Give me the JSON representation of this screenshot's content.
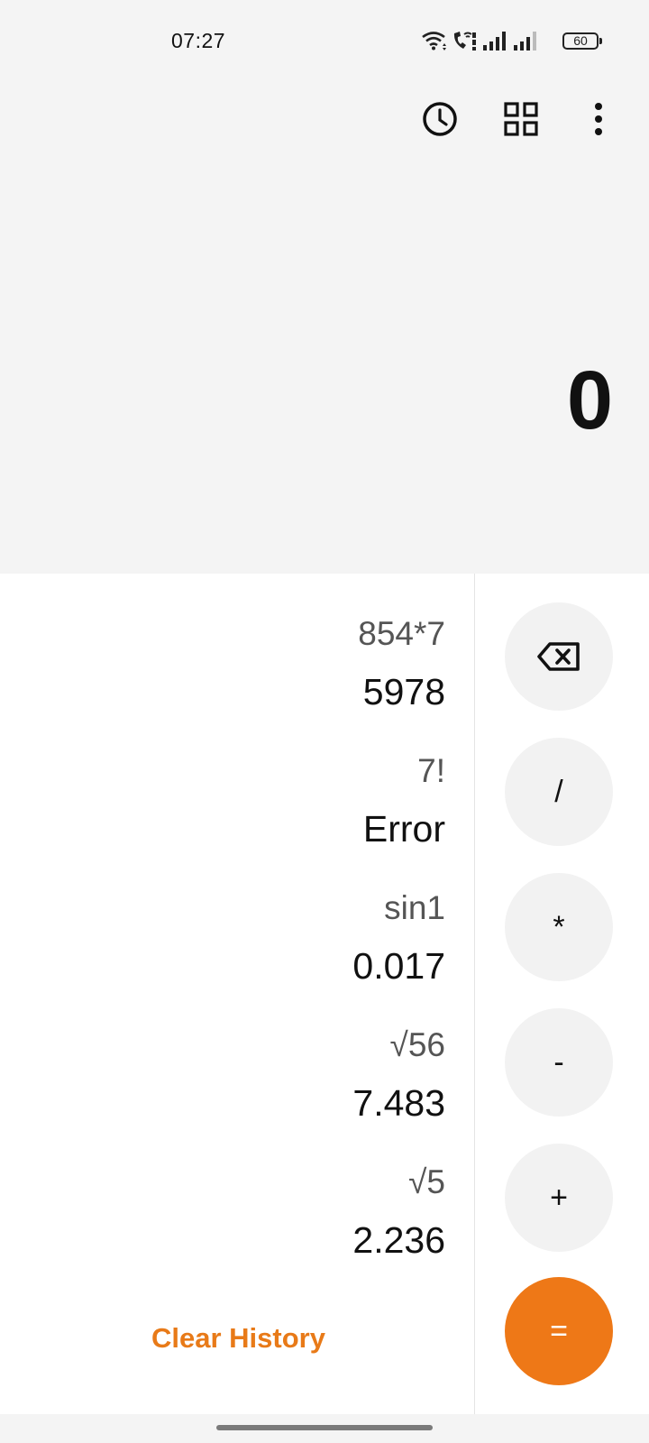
{
  "status_bar": {
    "time": "07:27",
    "battery": "60",
    "icons": [
      "wifi-icon",
      "call-wifi-icon",
      "signal-icon",
      "signal-icon",
      "battery-icon"
    ]
  },
  "toolbar": {
    "icons": [
      "history-icon",
      "grid-icon",
      "more-options-icon"
    ]
  },
  "display": {
    "value": "0"
  },
  "history": {
    "entries": [
      {
        "expression": "854*7",
        "result": "5978"
      },
      {
        "expression": "7!",
        "result": "Error"
      },
      {
        "expression": "sin1",
        "result": "0.017"
      },
      {
        "expression": "√56",
        "result": "7.483"
      },
      {
        "expression": "√5",
        "result": "2.236"
      }
    ],
    "clear_label": "Clear History"
  },
  "operators": {
    "backspace_icon": "backspace-icon",
    "divide": "/",
    "multiply": "*",
    "subtract": "-",
    "add": "+",
    "equals": "="
  },
  "colors": {
    "accent": "#ee7817",
    "background": "#f4f4f4",
    "panel": "#ffffff",
    "button": "#f2f2f2"
  }
}
